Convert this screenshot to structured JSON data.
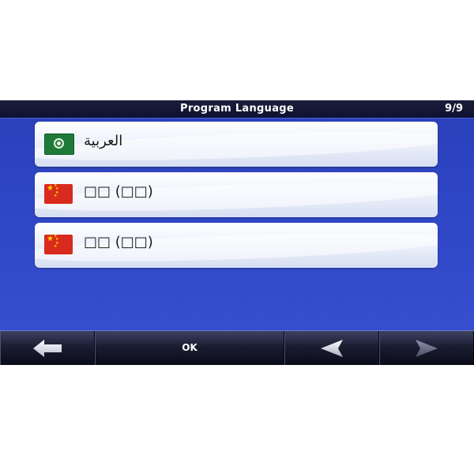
{
  "header": {
    "title": "Program Language",
    "page_count": "9/9"
  },
  "languages": [
    {
      "label": "العربية",
      "flag": "arab-league-flag"
    },
    {
      "label": "□□ (□□)",
      "flag": "china-flag"
    },
    {
      "label": "□□ (□□)",
      "flag": "china-flag"
    }
  ],
  "toolbar": {
    "ok_label": "OK",
    "back_icon": "back-arrow-icon",
    "prev_icon": "left-triangle-icon",
    "next_icon": "right-triangle-icon"
  },
  "colors": {
    "background": "#3048c4",
    "titlebar": "#14183a",
    "item": "#eef2fb",
    "china_red": "#d82a1d",
    "arab_green": "#1f7a3a"
  }
}
